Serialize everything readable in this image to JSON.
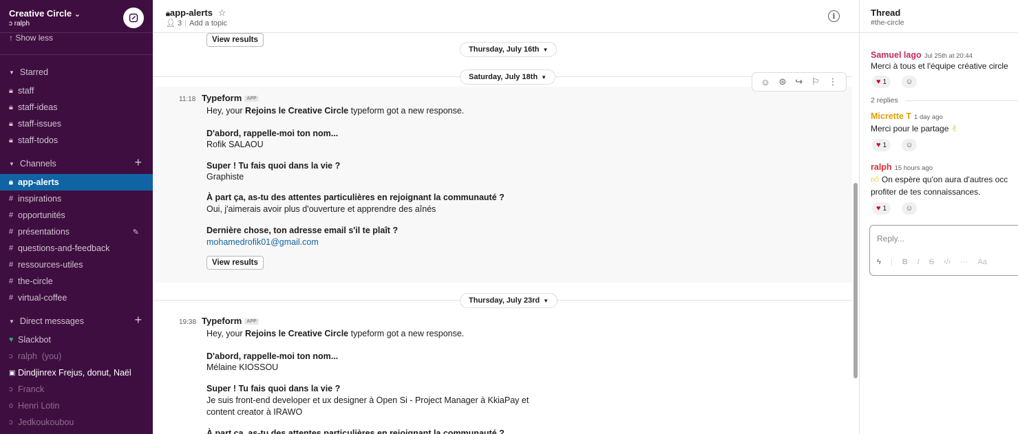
{
  "workspace": {
    "name": "Creative Circle",
    "name_chevron": "⌄",
    "user": "ralph"
  },
  "sidebar": {
    "show_less": "Show less",
    "starred": {
      "label": "Starred",
      "items": [
        "staff",
        "staff-ideas",
        "staff-issues",
        "staff-todos"
      ]
    },
    "channels": {
      "label": "Channels",
      "items": [
        "app-alerts",
        "inspirations",
        "opportunités",
        "présentations",
        "questions-and-feedback",
        "ressources-utiles",
        "the-circle",
        "virtual-coffee"
      ],
      "active": "app-alerts"
    },
    "direct_messages": {
      "label": "Direct messages",
      "items": [
        "Slackbot",
        "ralph",
        "Dindjinrex Frejus, donut, Naël",
        "Franck",
        "Henri Lotin",
        "Jedkoukoubou"
      ],
      "ralph_suffix": "(you)"
    }
  },
  "channel": {
    "name": "app-alerts",
    "members": "3",
    "add_topic": "Add a topic"
  },
  "messages": {
    "view_results": "View results",
    "dates": [
      "Thursday, July 16th",
      "Saturday, July 18th",
      "Thursday, July 23rd"
    ],
    "app_badge": "APP",
    "msg1": {
      "time": "11:18",
      "author": "Typeform",
      "intro_pre": "Hey, your ",
      "intro_bold": "Rejoins le Creative Circle",
      "intro_post": " typeform got a new response.",
      "q1": "D'abord, rappelle-moi ton nom...",
      "a1": "Rofik SALAOU",
      "q2": "Super ! Tu fais quoi dans la vie ?",
      "a2": "Graphiste",
      "q3": "À part ça, as-tu des attentes particulières en rejoignant la communauté ?",
      "a3": "Oui, j'aimerais avoir plus d'ouverture et apprendre des aînés",
      "q4": "Dernière chose, ton adresse email s'il te plaît ?",
      "a4": "mohamedrofik01@gmail.com"
    },
    "msg2": {
      "time": "19:38",
      "author": "Typeform",
      "intro_pre": "Hey, your ",
      "intro_bold": "Rejoins le Creative Circle",
      "intro_post": " typeform got a new response.",
      "q1": "D'abord, rappelle-moi ton nom...",
      "a1": "Mélaine KIOSSOU",
      "q2": "Super ! Tu fais quoi dans la vie ?",
      "a2_line1": "Je suis front-end developer et ux designer à Open Si - Project Manager à KkiaPay et",
      "a2_line2": "content creator à IRAWO",
      "q3": "À part ça, as-tu des attentes particulières en rejoignant la communauté ?"
    }
  },
  "thread": {
    "title": "Thread",
    "channel": "#the-circle",
    "root": {
      "author": "Samuel lago",
      "time": "Jul 25th at 20:44",
      "text": "Merci à tous et l'équipe créative circle",
      "reaction_count": "1"
    },
    "replies_label": "2 replies",
    "reply1": {
      "author": "Micrette T",
      "time": "1 day ago",
      "text": "Merci pour le partage",
      "reaction_count": "1"
    },
    "reply2": {
      "author": "ralph",
      "time": "15 hours ago",
      "text1": "On espère qu'on aura d'autres occ",
      "text2": "profiter de tes connaissances.",
      "reaction_count": "1"
    },
    "reply_placeholder": "Reply...",
    "format_aa": "Aa"
  },
  "colors": {
    "sidebar_bg": "#3f0e40",
    "active_item": "#1164a3",
    "link": "#1264a3",
    "samuel": "#c52a5b",
    "micrette": "#e0a000",
    "ralph": "#d9302f",
    "slackbot": "#2bac76"
  }
}
